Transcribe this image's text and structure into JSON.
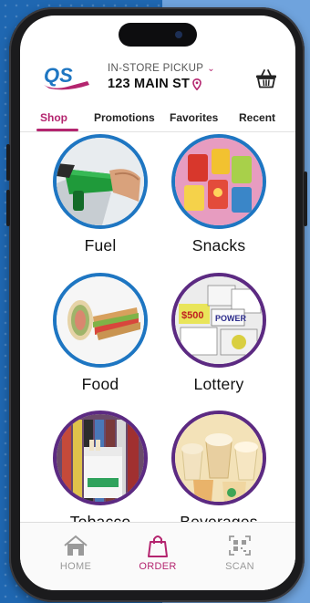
{
  "header": {
    "logo_text": "QS",
    "pickup_label": "IN-STORE PICKUP",
    "address": "123 MAIN ST"
  },
  "tabs": [
    {
      "label": "Shop",
      "active": true
    },
    {
      "label": "Promotions",
      "active": false
    },
    {
      "label": "Favorites",
      "active": false
    },
    {
      "label": "Recent",
      "active": false
    }
  ],
  "categories": [
    {
      "label": "Fuel",
      "icon": "fuel-nozzle-image"
    },
    {
      "label": "Snacks",
      "icon": "snack-bags-image"
    },
    {
      "label": "Food",
      "icon": "sandwich-wrap-image"
    },
    {
      "label": "Lottery",
      "icon": "lottery-tickets-image"
    },
    {
      "label": "Tobacco",
      "icon": "cigarette-pack-image"
    },
    {
      "label": "Beverages",
      "icon": "frozen-drinks-image"
    }
  ],
  "nav": {
    "home": "HOME",
    "order": "ORDER",
    "scan": "SCAN"
  },
  "colors": {
    "accent": "#b4256f",
    "blue_ring": "#1e76c2",
    "purple_ring": "#5c2a82"
  }
}
